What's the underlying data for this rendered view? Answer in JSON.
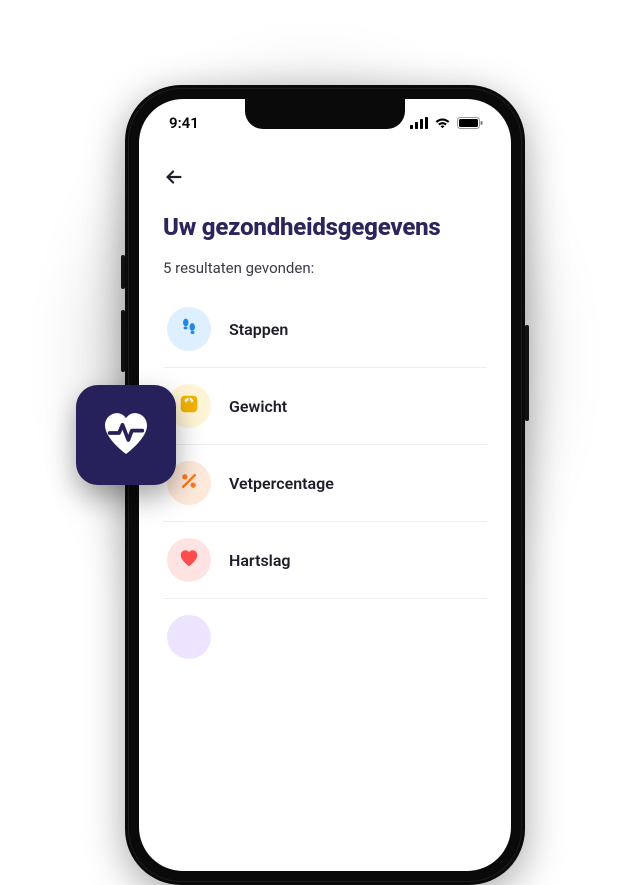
{
  "status": {
    "time": "9:41"
  },
  "header": {
    "title": "Uw gezondheidsgegevens",
    "subtitle": "5 resultaten gevonden:"
  },
  "list": {
    "items": [
      {
        "label": "Stappen",
        "icon": "footsteps-icon",
        "bg": "bg-blue",
        "fg": "#1e88e5"
      },
      {
        "label": "Gewicht",
        "icon": "scale-icon",
        "bg": "bg-yellow",
        "fg": "#f2b300"
      },
      {
        "label": "Vetpercentage",
        "icon": "percent-icon",
        "bg": "bg-orange",
        "fg": "#ff7a1a"
      },
      {
        "label": "Hartslag",
        "icon": "heart-icon",
        "bg": "bg-red",
        "fg": "#ff4d4d"
      },
      {
        "label": "",
        "icon": "dot-icon",
        "bg": "bg-purple",
        "fg": "#b06cff"
      }
    ]
  },
  "floating_tile": {
    "icon": "heart-pulse-icon"
  }
}
